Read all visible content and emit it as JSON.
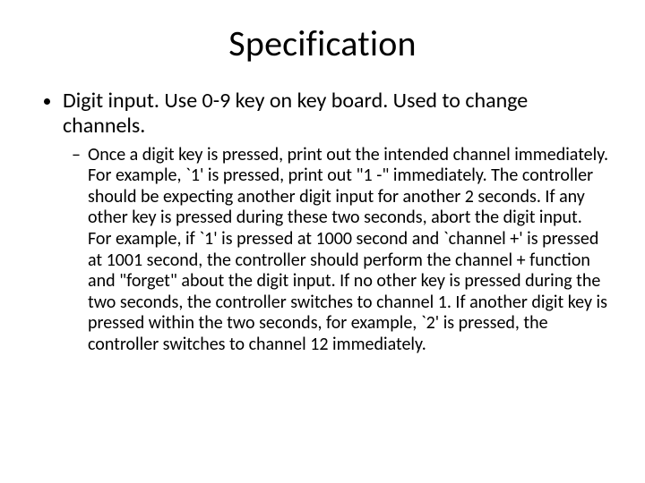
{
  "title": "Specification",
  "bullet1": "Digit input. Use 0-9 key on key board. Used to change channels.",
  "sub1": "Once a digit key is pressed, print out the intended channel immediately. For example, `1' is pressed, print out \"1 -\" immediately. The controller should be expecting another digit input for another 2 seconds. If any other key is pressed during these two seconds, abort the digit input. For example, if `1' is pressed at 1000 second and `channel +' is pressed at 1001 second, the controller should perform the channel + function and \"forget\" about the digit input. If no other key is pressed during the two seconds, the controller switches to channel 1. If another digit key is pressed within the two seconds,  for example, `2' is pressed, the controller switches to channel 12 immediately."
}
